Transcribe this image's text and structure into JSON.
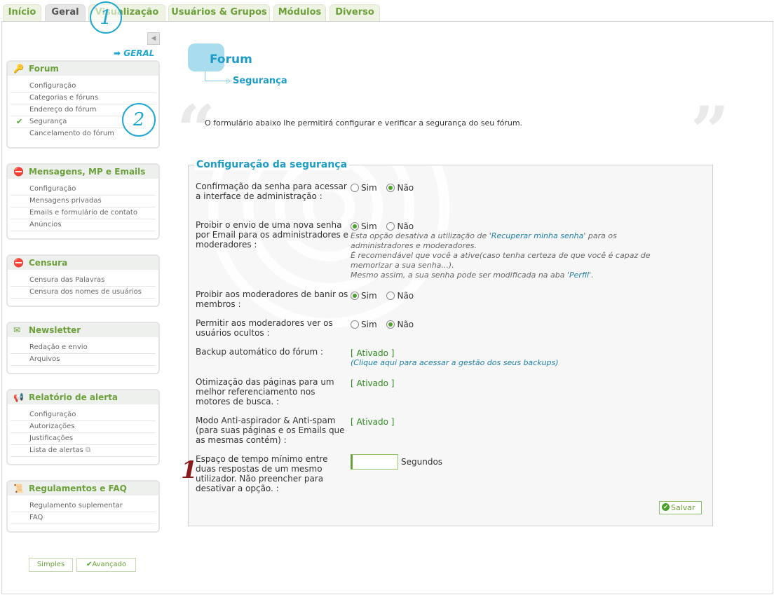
{
  "tabs": [
    "Início",
    "Geral",
    "Visualização",
    "Usuários & Grupos",
    "Módulos",
    "Diverso"
  ],
  "callouts": {
    "tab_number": "1",
    "side_number": "2",
    "field_number": "1"
  },
  "sidebar": {
    "collapse_label": "◀",
    "section_link": "GERAL",
    "boxes": [
      {
        "title": "Forum",
        "icon": "key-icon",
        "items": [
          "Configuração",
          "Categorias e fóruns",
          "Endereço do fórum",
          "Segurança",
          "Cancelamento do fórum"
        ]
      },
      {
        "title": "Mensagens, MP e Emails",
        "icon": "message-stop-icon",
        "items": [
          "Configuração",
          "Mensagens privadas",
          "Emails e formulário de contato",
          "Anúncios"
        ]
      },
      {
        "title": "Censura",
        "icon": "censor-icon",
        "items": [
          "Censura das Palavras",
          "Censura dos nomes de usuários"
        ]
      },
      {
        "title": "Newsletter",
        "icon": "newsletter-icon",
        "items": [
          "Redação e envio",
          "Arquivos"
        ]
      },
      {
        "title": "Relatório de alerta",
        "icon": "alert-report-icon",
        "items": [
          "Configuração",
          "Autorizações",
          "Justificações",
          "Lista de alertas"
        ]
      },
      {
        "title": "Regulamentos e FAQ",
        "icon": "rules-icon",
        "items": [
          "Regulamento suplementar",
          "FAQ"
        ]
      }
    ],
    "selected_item": "Segurança",
    "mode_buttons": {
      "simple": "Simples",
      "advanced": "Avançado"
    }
  },
  "main": {
    "title": "Forum",
    "subtitle": "Segurança",
    "intro": "O formulário abaixo lhe permitirá configurar e verificar a segurança do seu fórum.",
    "panel_title": "Configuração da segurança",
    "options": {
      "yes": "Sim",
      "no": "Não"
    },
    "rows": [
      {
        "label": "Confirmação da senha para acessar a interface de administração :",
        "selected": "no"
      },
      {
        "label": "Proibir o envio de uma nova senha por Email para os administradores e moderadores :",
        "selected": "yes",
        "hint_pre": "Esta opção desativa a utilização de '",
        "hint_link": "Recuperar minha senha",
        "hint_mid": "' para os administradores e moderadores.",
        "hint_2": "É recomendável que você a ative(caso tenha certeza de que você é capaz de memorizar a sua senha...).",
        "hint_3_pre": "Mesmo assim, a sua senha pode ser modificada na aba '",
        "hint_3_link": "Perfil",
        "hint_3_post": "'."
      },
      {
        "label": "Proibir aos moderadores de banir os membros :",
        "selected": "yes"
      },
      {
        "label": "Permitir aos moderadores ver os usuários ocultos :",
        "selected": "no"
      },
      {
        "label": "Backup automático do fórum :",
        "value": "[ Ativado ]",
        "hint": "(Clique aqui para acessar a gestão dos seus backups)"
      },
      {
        "label": "Otimização das páginas para um melhor referenciamento nos motores de busca. :",
        "value": "[ Ativado ]"
      },
      {
        "label": "Modo Anti-aspirador & Anti-spam (para suas páginas e os Emails que as mesmas contém) :",
        "value": "[ Ativado ]"
      },
      {
        "label": "Espaço de tempo mínimo entre duas respostas de um mesmo utilizador. Não preencher para desativar a opção. :",
        "input_value": "",
        "unit": "Segundos"
      }
    ],
    "save_label": "Salvar"
  },
  "colors": {
    "accent_green": "#6ca03a",
    "accent_blue": "#1c9cc6",
    "callout_blue": "#22a7d1",
    "callout_red": "#8b1a1a"
  }
}
